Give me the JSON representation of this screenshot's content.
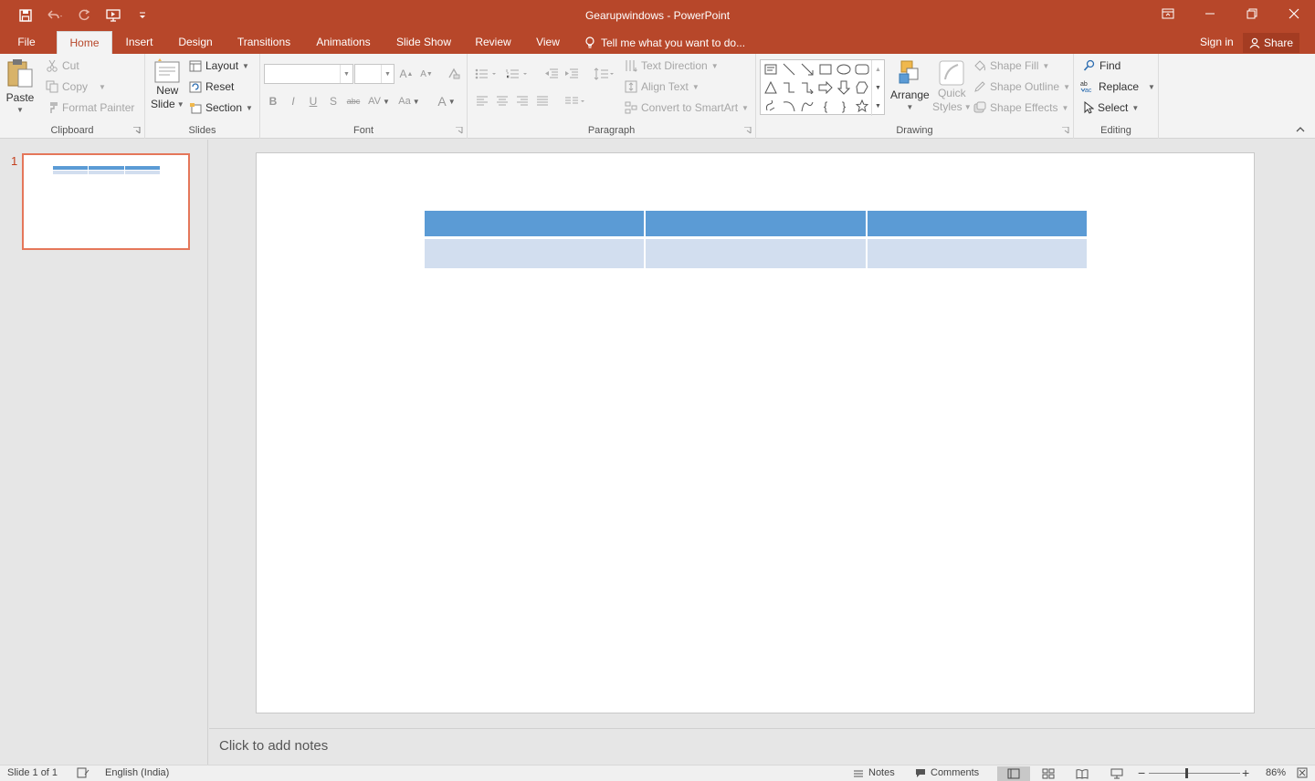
{
  "app": {
    "title": "Gearupwindows - PowerPoint",
    "accent": "#b7472a"
  },
  "qat": {
    "icons": [
      "save-icon",
      "undo-icon",
      "redo-icon",
      "present-from-beginning-icon",
      "customize-qat-icon"
    ]
  },
  "tabs": [
    {
      "label": "File",
      "active": false
    },
    {
      "label": "Home",
      "active": true
    },
    {
      "label": "Insert",
      "active": false
    },
    {
      "label": "Design",
      "active": false
    },
    {
      "label": "Transitions",
      "active": false
    },
    {
      "label": "Animations",
      "active": false
    },
    {
      "label": "Slide Show",
      "active": false
    },
    {
      "label": "Review",
      "active": false
    },
    {
      "label": "View",
      "active": false
    }
  ],
  "tellme": "Tell me what you want to do...",
  "account": {
    "signin": "Sign in",
    "share": "Share"
  },
  "ribbon": {
    "clipboard": {
      "label": "Clipboard",
      "paste": "Paste",
      "cut": "Cut",
      "copy": "Copy",
      "format_painter": "Format Painter"
    },
    "slides": {
      "label": "Slides",
      "new_slide_1": "New",
      "new_slide_2": "Slide",
      "layout": "Layout",
      "reset": "Reset",
      "section": "Section"
    },
    "font": {
      "label": "Font",
      "font_name": "",
      "font_size": "",
      "case": "Aa"
    },
    "paragraph": {
      "label": "Paragraph",
      "text_direction": "Text Direction",
      "align_text": "Align Text",
      "convert_smartart": "Convert to SmartArt"
    },
    "drawing": {
      "label": "Drawing",
      "arrange": "Arrange",
      "quick_styles_1": "Quick",
      "quick_styles_2": "Styles",
      "shape_fill": "Shape Fill",
      "shape_outline": "Shape Outline",
      "shape_effects": "Shape Effects"
    },
    "editing": {
      "label": "Editing",
      "find": "Find",
      "replace": "Replace",
      "select": "Select"
    }
  },
  "thumbnails": [
    {
      "number": "1",
      "selected": true
    }
  ],
  "slide": {
    "table": {
      "header_color": "#5b9bd5",
      "body_color": "#d2deef",
      "rows": [
        [
          "",
          "",
          ""
        ],
        [
          "",
          "",
          ""
        ]
      ]
    }
  },
  "notes": {
    "placeholder": "Click to add notes"
  },
  "status": {
    "slide_info": "Slide 1 of 1",
    "language": "English (India)",
    "notes": "Notes",
    "comments": "Comments",
    "zoom": "86%",
    "zoom_fraction": 0.86
  }
}
